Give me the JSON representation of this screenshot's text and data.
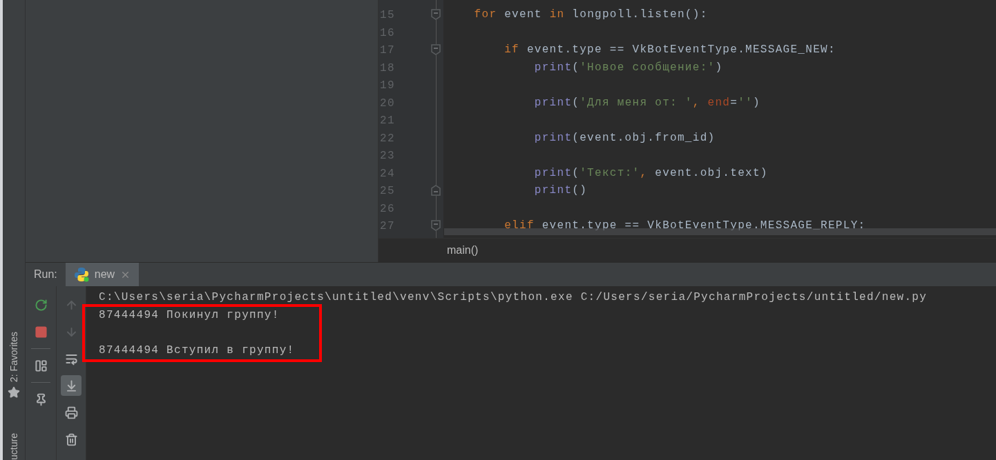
{
  "side_strip": {
    "tabs": [
      {
        "label": "2: Favorites",
        "kind": "favorites"
      },
      {
        "label": "ucture",
        "kind": "structure"
      }
    ]
  },
  "editor": {
    "lines": [
      {
        "number": "15",
        "kind": "fold_start",
        "tokens": [
          {
            "kind": "keyword",
            "text": "for "
          },
          {
            "kind": "plain",
            "text": "event "
          },
          {
            "kind": "keyword",
            "text": "in "
          },
          {
            "kind": "plain",
            "text": "longpoll.listen():"
          }
        ],
        "children": [
          {
            "number": "16",
            "kind": "plain"
          },
          {
            "number": "17",
            "kind": "fold_start",
            "tokens": [
              {
                "kind": "keyword",
                "text": "if "
              },
              {
                "kind": "plain",
                "text": "event.type == VkBotEventType.MESSAGE_NEW:"
              }
            ],
            "children": [
              {
                "number": "18",
                "kind": "plain",
                "tokens": [
                  {
                    "kind": "builtin",
                    "text": "print"
                  },
                  {
                    "kind": "plain",
                    "text": "("
                  },
                  {
                    "kind": "string",
                    "text": "'Новое сообщение:'"
                  },
                  {
                    "kind": "plain",
                    "text": ")"
                  }
                ]
              },
              {
                "number": "19",
                "kind": "plain"
              },
              {
                "number": "20",
                "kind": "plain",
                "tokens": [
                  {
                    "kind": "builtin",
                    "text": "print"
                  },
                  {
                    "kind": "plain",
                    "text": "("
                  },
                  {
                    "kind": "string",
                    "text": "'Для меня от: '"
                  },
                  {
                    "kind": "keyword",
                    "text": ", "
                  },
                  {
                    "kind": "param",
                    "text": "end"
                  },
                  {
                    "kind": "plain",
                    "text": "="
                  },
                  {
                    "kind": "string",
                    "text": "''"
                  },
                  {
                    "kind": "plain",
                    "text": ")"
                  }
                ]
              },
              {
                "number": "21",
                "kind": "plain"
              },
              {
                "number": "22",
                "kind": "plain",
                "tokens": [
                  {
                    "kind": "builtin",
                    "text": "print"
                  },
                  {
                    "kind": "plain",
                    "text": "(event.obj.from_id)"
                  }
                ]
              },
              {
                "number": "23",
                "kind": "plain"
              },
              {
                "number": "24",
                "kind": "plain",
                "tokens": [
                  {
                    "kind": "builtin",
                    "text": "print"
                  },
                  {
                    "kind": "plain",
                    "text": "("
                  },
                  {
                    "kind": "string",
                    "text": "'Текст:'"
                  },
                  {
                    "kind": "keyword",
                    "text": ", "
                  },
                  {
                    "kind": "plain",
                    "text": "event.obj.text)"
                  }
                ]
              },
              {
                "number": "25",
                "kind": "fold_end",
                "tokens": [
                  {
                    "kind": "builtin",
                    "text": "print"
                  },
                  {
                    "kind": "plain",
                    "text": "()"
                  }
                ]
              }
            ]
          },
          {
            "number": "26",
            "kind": "plain"
          },
          {
            "number": "27",
            "kind": "fold_start",
            "tokens": [
              {
                "kind": "keyword",
                "text": "elif "
              },
              {
                "kind": "plain",
                "text": "event.type == VkBotEventType.MESSAGE_REPLY:"
              }
            ]
          }
        ]
      }
    ],
    "breadcrumb": "main()"
  },
  "run_panel": {
    "label": "Run:",
    "tabs": [
      {
        "label": "new",
        "selected": true
      }
    ],
    "left_toolbar": [
      {
        "kind": "rerun",
        "disabled": false,
        "selected": false
      },
      {
        "kind": "stop",
        "disabled": false,
        "selected": false
      },
      {
        "kind": "divider"
      },
      {
        "kind": "layout",
        "disabled": false,
        "selected": false
      },
      {
        "kind": "divider"
      },
      {
        "kind": "pin",
        "disabled": false,
        "selected": false
      }
    ],
    "right_toolbar": [
      {
        "kind": "up",
        "disabled": true,
        "selected": false
      },
      {
        "kind": "down",
        "disabled": true,
        "selected": false
      },
      {
        "kind": "wrap",
        "disabled": false,
        "selected": false
      },
      {
        "kind": "scroll_end",
        "disabled": false,
        "selected": true
      },
      {
        "kind": "print",
        "disabled": false,
        "selected": false
      },
      {
        "kind": "trash",
        "disabled": false,
        "selected": false
      }
    ],
    "console": [
      {
        "kind": "text",
        "text": "C:\\Users\\seria\\PycharmProjects\\untitled\\venv\\Scripts\\python.exe C:/Users/seria/PycharmProjects/untitled/new.py",
        "highlighted": false
      },
      {
        "kind": "text",
        "text": "87444494 Покинул группу!",
        "highlighted": true
      },
      {
        "kind": "blank",
        "highlighted": true
      },
      {
        "kind": "text",
        "text": "87444494 Вступил в группу!",
        "highlighted": true
      }
    ]
  }
}
